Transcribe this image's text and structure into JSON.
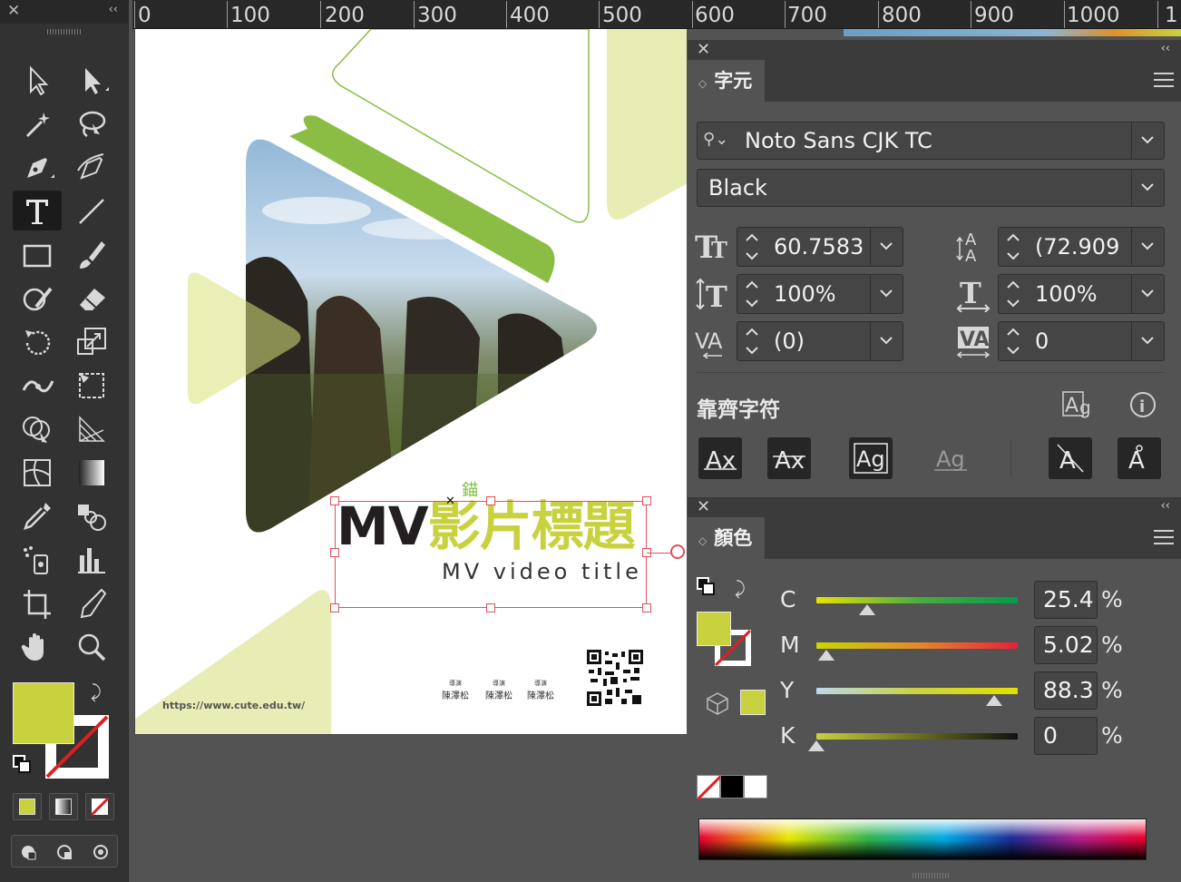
{
  "ruler": {
    "labels": [
      "0",
      "100",
      "200",
      "300",
      "400",
      "500",
      "600",
      "700",
      "800",
      "900",
      "1000",
      "1"
    ]
  },
  "artboard": {
    "title_mv": "MV",
    "title_cn": "影片標題",
    "subtitle": "MV video title",
    "anchor_label": "錨",
    "url": "https://www.cute.edu.tw/",
    "credits": [
      {
        "role": "導演",
        "name": "陳澤松"
      },
      {
        "role": "導演",
        "name": "陳澤松"
      },
      {
        "role": "導演",
        "name": "陳澤松"
      }
    ]
  },
  "character_panel": {
    "tab": "字元",
    "font_family": "Noto Sans CJK TC",
    "font_style": "Black",
    "font_size": "60.7583",
    "leading": "(72.909",
    "vertical_scale": "100%",
    "horizontal_scale": "100%",
    "kerning": "(0)",
    "tracking": "0",
    "snap_section": "靠齊字符"
  },
  "color_panel": {
    "tab": "顏色",
    "channels": [
      {
        "label": "C",
        "value": "25.4",
        "unit": "%",
        "level": 0.254
      },
      {
        "label": "M",
        "value": "5.02",
        "unit": "%",
        "level": 0.0502
      },
      {
        "label": "Y",
        "value": "88.3",
        "unit": "%",
        "level": 0.883
      },
      {
        "label": "K",
        "value": "0",
        "unit": "%",
        "level": 0
      }
    ]
  },
  "colors": {
    "fill": "#c8d23f",
    "accent_green": "#8bbd45",
    "pale_green": "#e8edb5",
    "selection": "#e0505a"
  }
}
